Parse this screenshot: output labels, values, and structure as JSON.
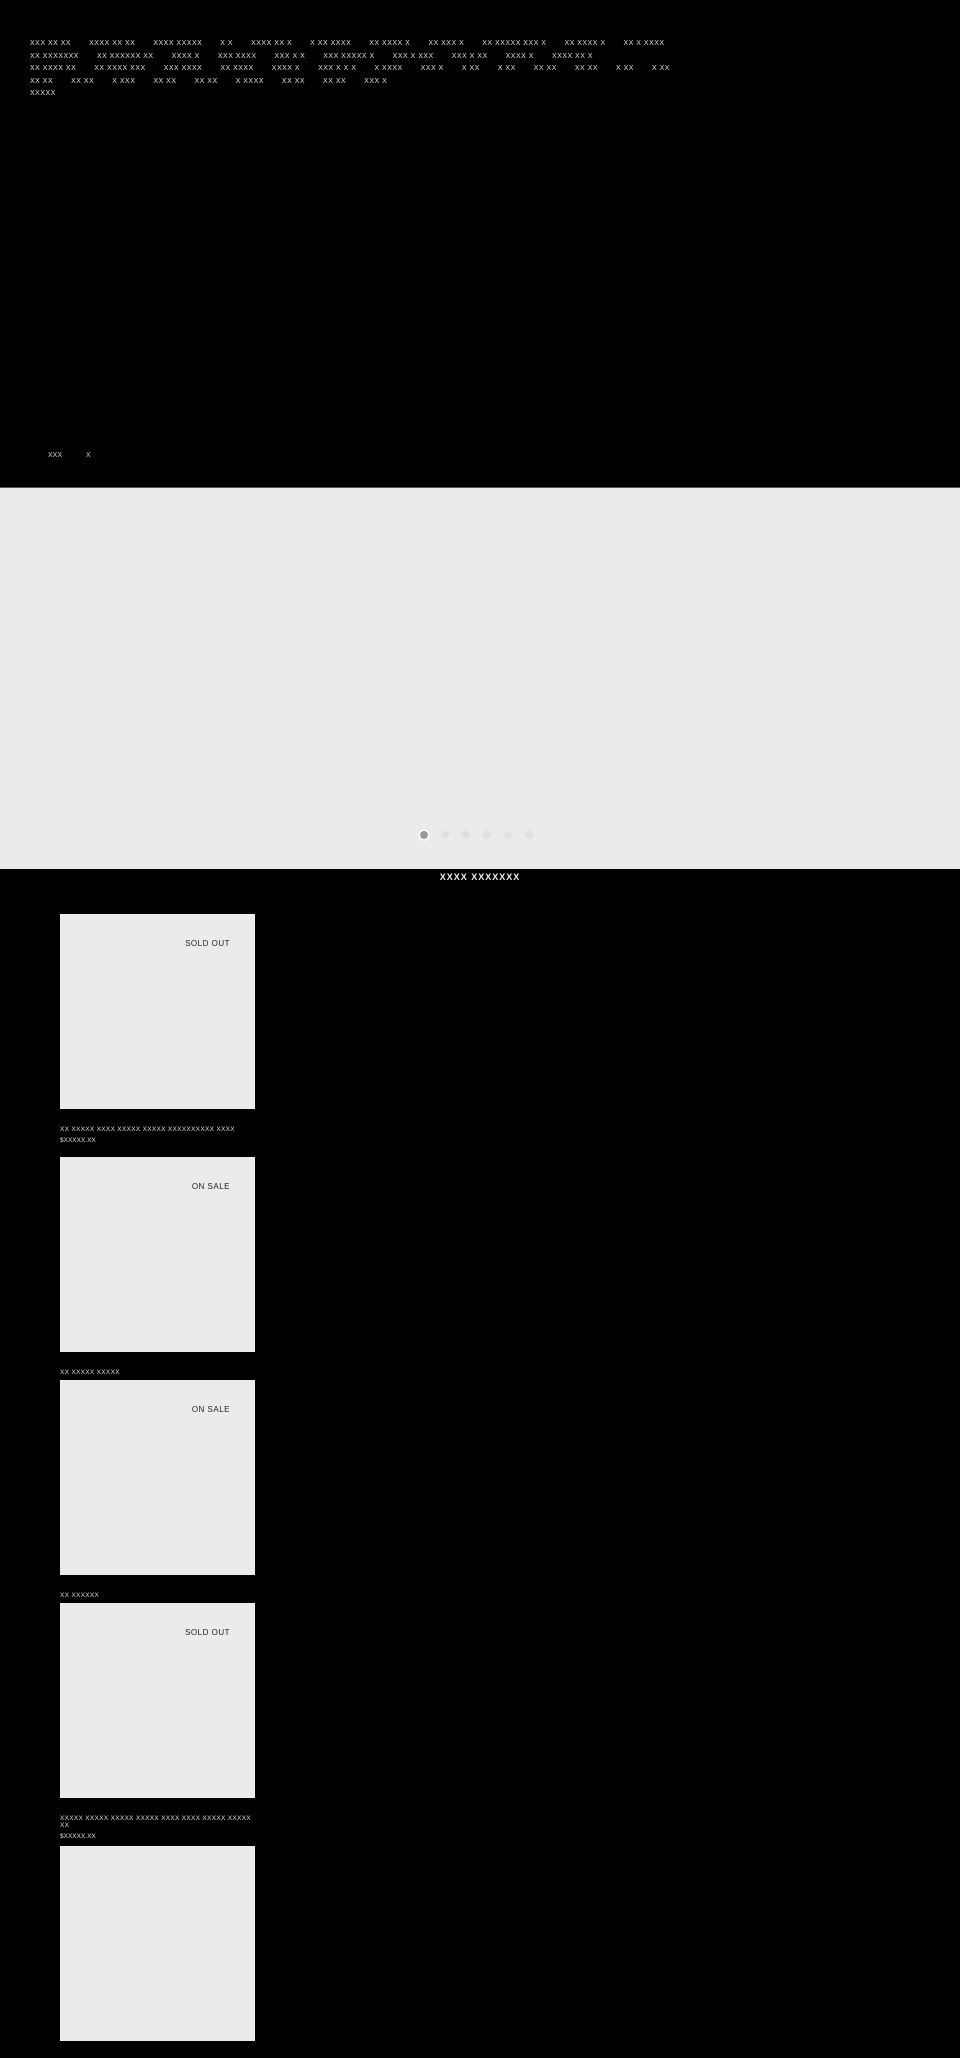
{
  "menu": {
    "items": [
      "XXX XX XX",
      "XXXX XX XX",
      "XXXX XXXXX",
      "X X",
      "XXXX XX X",
      "X XX XXXX",
      "XX XXXX X",
      "XX XXX X",
      "XX XXXXX XXX X",
      "XX XXXX X",
      "XX X XXXX",
      "XX XXXXXXX",
      "XX XXXXXX XX",
      "XXXX X",
      "XXX XXXX",
      "XXX X X",
      "XXX XXXXX X",
      "XXX X XXX",
      "XXX X XX",
      "XXXX X",
      "XXXX XX X",
      "XX XXXX XX",
      "XX XXXX XXX",
      "XXX XXXX",
      "XX XXXX",
      "XXXX X",
      "XXX X X X",
      "X XXXX",
      "XXX X",
      "X XX",
      "X XX",
      "XX XX",
      "XX XX",
      "X XX",
      "X XX",
      "XX XX",
      "XX XX",
      "X XXX",
      "XX XX",
      "XX XX",
      "X XXXX",
      "XX XX",
      "XX XX",
      "XXX X",
      "XXXXX"
    ]
  },
  "language": {
    "label": "XXX",
    "close": "X"
  },
  "hero": {
    "slides": 6,
    "active_slide": 1
  },
  "section": {
    "title": "XXXX XXXXXXX"
  },
  "products": [
    {
      "badge": "SOLD OUT",
      "title": "XX XXXXX XXXX XXXXX XXXXX XXXXXXXXXX XXXX",
      "price": "$XXXXX.XX"
    },
    {
      "badge": "ON SALE",
      "title": "XX XXXXX XXXXX",
      "price": ""
    },
    {
      "badge": "ON SALE",
      "title": "XX XXXXXX",
      "price": ""
    },
    {
      "badge": "SOLD OUT",
      "title": "XXXXX XXXXX XXXXX XXXXX XXXX XXXX XXXXX XXXXX XX",
      "price": "$XXXXX.XX"
    },
    {
      "badge": "",
      "title": "",
      "price": ""
    }
  ]
}
